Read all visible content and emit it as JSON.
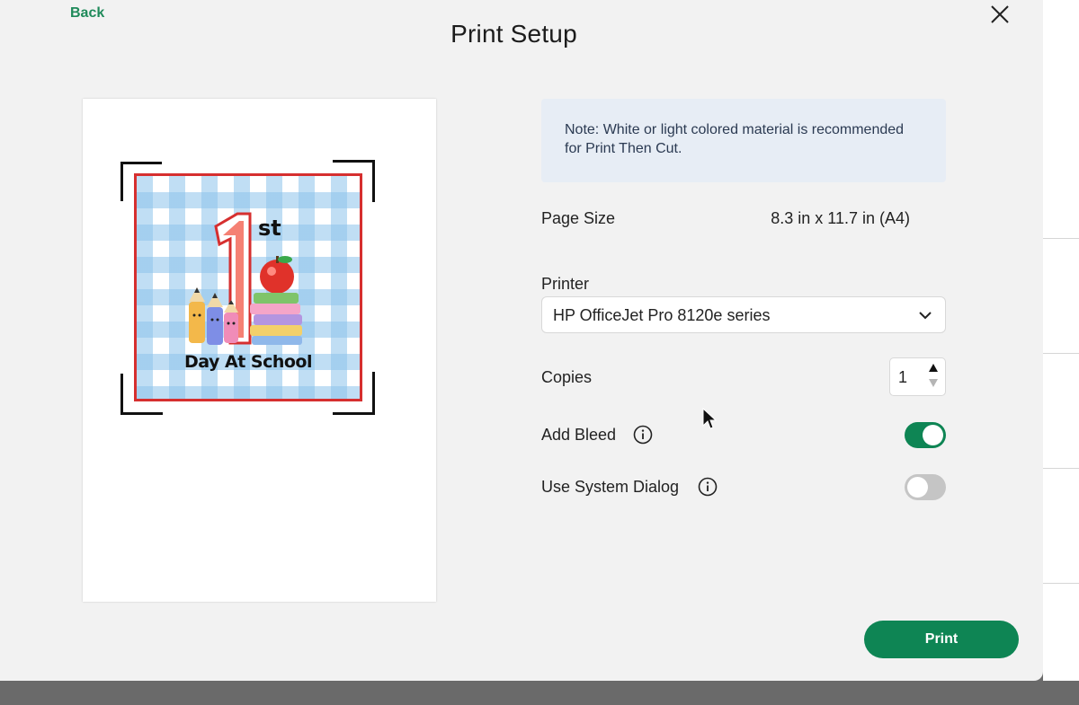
{
  "header": {
    "back_label": "Back",
    "title": "Print Setup",
    "close_icon": "close-icon"
  },
  "preview": {
    "artwork_text_number": "1",
    "artwork_text_suffix": "st",
    "artwork_caption": "Day At School",
    "colors": {
      "border": "#d62f2f",
      "gingham": "#8cc3eb"
    }
  },
  "settings": {
    "note": "Note: White or light colored material is recommended for Print Then Cut.",
    "page_size_label": "Page Size",
    "page_size_value": "8.3 in x 11.7 in (A4)",
    "printer_label": "Printer",
    "printer_value": "HP OfficeJet Pro 8120e series",
    "copies_label": "Copies",
    "copies_value": "1",
    "add_bleed_label": "Add Bleed",
    "add_bleed_on": true,
    "system_dialog_label": "Use System Dialog",
    "system_dialog_on": false
  },
  "actions": {
    "print_label": "Print"
  },
  "colors": {
    "accent": "#0e8554",
    "link": "#1f8a5a"
  }
}
